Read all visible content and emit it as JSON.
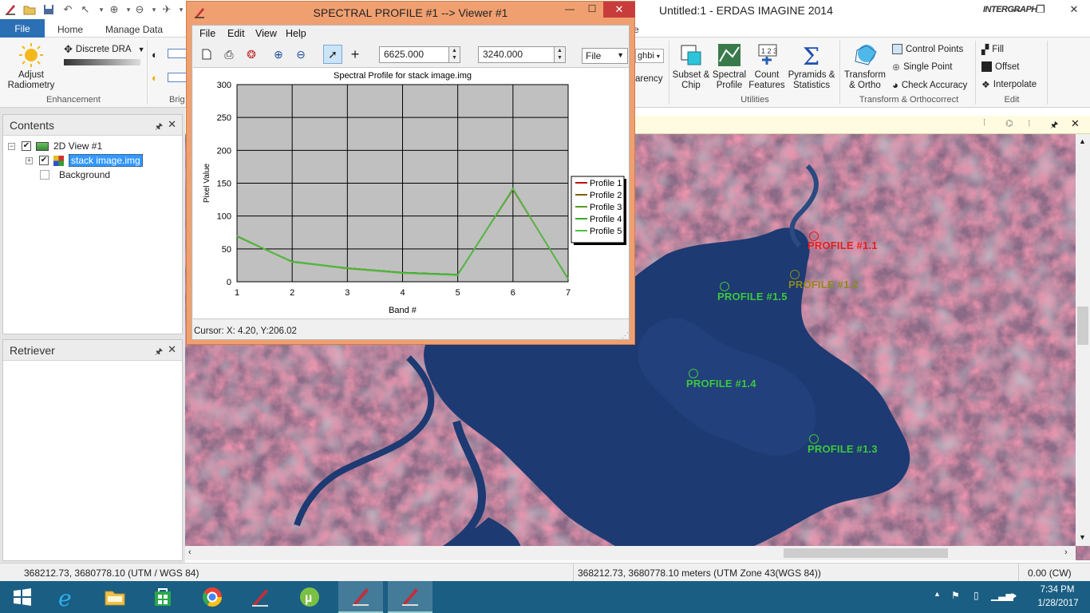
{
  "app": {
    "title": "Untitled:1 - ERDAS IMAGINE 2014",
    "logo": "INTERGRAPH"
  },
  "ribbon_tabs": [
    "File",
    "Home",
    "Manage Data"
  ],
  "ribbon": {
    "adjust_radiometry": "Adjust Radiometry",
    "discrete_dra": "Discrete DRA",
    "enhancement_group": "Enhancement",
    "brightness_group_partial": "Brig",
    "neighborhood_partial": "ghbi",
    "transparency_partial": "arency",
    "subset_chip": "Subset & Chip",
    "spectral_profile": "Spectral Profile",
    "count_features": "Count Features",
    "pyramids_statistics": "Pyramids & Statistics",
    "utilities_group": "Utilities",
    "transform_ortho": "Transform & Ortho",
    "control_points": "Control Points",
    "single_point": "Single Point",
    "check_accuracy": "Check Accuracy",
    "transform_group": "Transform & Orthocorrect",
    "fill": "Fill",
    "offset": "Offset",
    "interpolate": "Interpolate",
    "edit_group": "Edit",
    "tab_partial": "e"
  },
  "contents": {
    "title": "Contents",
    "tree": [
      "2D View #1",
      "stack image.img",
      "Background"
    ]
  },
  "retriever": {
    "title": "Retriever"
  },
  "viewer": {
    "profiles": [
      {
        "label": "PROFILE #1.1",
        "color": "#e02020"
      },
      {
        "label": "PROFILE #1.2",
        "color": "#8a8a20"
      },
      {
        "label": "PROFILE #1.5",
        "color": "#3cc83c"
      },
      {
        "label": "PROFILE #1.4",
        "color": "#3cc83c"
      },
      {
        "label": "PROFILE #1.3",
        "color": "#3cc83c"
      }
    ]
  },
  "spectral_window": {
    "title": "SPECTRAL PROFILE #1 --> Viewer #1",
    "menu": [
      "File",
      "Edit",
      "View",
      "Help"
    ],
    "x_coord": "6625.000",
    "y_coord": "3240.000",
    "file_select": "File",
    "cursor": "Cursor: X: 4.20, Y:206.02"
  },
  "chart_data": {
    "type": "line",
    "title": "Spectral Profile for stack image.img",
    "xlabel": "Band #",
    "ylabel": "Pixel Value",
    "x": [
      1,
      2,
      3,
      4,
      5,
      6,
      7
    ],
    "xlim": [
      1,
      7
    ],
    "ylim": [
      0,
      300
    ],
    "yticks": [
      0,
      50,
      100,
      150,
      200,
      250,
      300
    ],
    "grid": true,
    "legend_position": "right",
    "series": [
      {
        "name": "Profile 1",
        "color": "#c01010",
        "values": [
          70,
          30,
          21,
          14,
          11,
          140,
          5
        ]
      },
      {
        "name": "Profile 2",
        "color": "#7a6010",
        "values": [
          69,
          30,
          21,
          14,
          11,
          141,
          4
        ]
      },
      {
        "name": "Profile 3",
        "color": "#5a9a20",
        "values": [
          69,
          30,
          20,
          13,
          10,
          141,
          5
        ]
      },
      {
        "name": "Profile 4",
        "color": "#3aa830",
        "values": [
          69,
          31,
          21,
          14,
          11,
          142,
          4
        ]
      },
      {
        "name": "Profile 5",
        "color": "#50c040",
        "values": [
          70,
          30,
          21,
          13,
          10,
          141,
          5
        ]
      }
    ]
  },
  "status": {
    "left": "368212.73, 3680778.10  (UTM / WGS 84)",
    "center": "368212.73, 3680778.10 meters (UTM Zone 43(WGS 84))",
    "right": "0.00 (CW)"
  },
  "taskbar": {
    "time": "7:34 PM",
    "date": "1/28/2017"
  }
}
